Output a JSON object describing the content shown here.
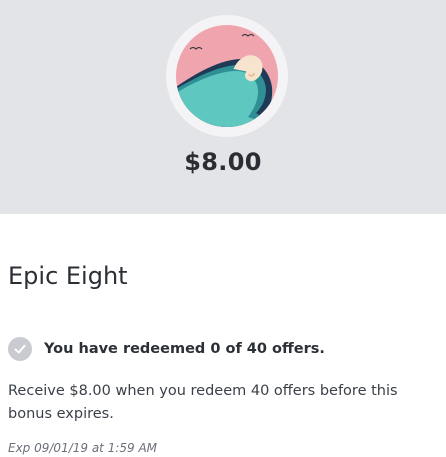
{
  "hero": {
    "badge_icon": "wave-badge-icon",
    "amount": "$8.00",
    "colors": {
      "background": "#e3e4e7",
      "sky": "#f0a4ad",
      "wave": "#5ec8c0",
      "wave_dark": "#1e3a57"
    }
  },
  "offer": {
    "title": "Epic Eight",
    "status_icon": "checkmark-circle-icon",
    "status_text": "You have redeemed 0 of 40 offers.",
    "description": "Receive $8.00 when you redeem 40 offers before this bonus expires.",
    "expiry": "Exp 09/01/19 at 1:59 AM"
  }
}
